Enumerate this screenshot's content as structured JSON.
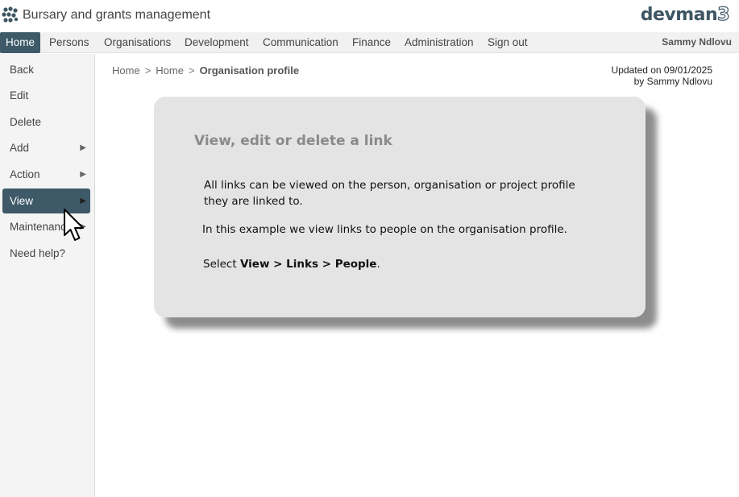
{
  "header": {
    "app_title": "Bursary and grants management",
    "brand_text": "devman",
    "brand_num": "3",
    "logo_icon": "molecule-dots-icon"
  },
  "topnav": {
    "items": [
      "Home",
      "Persons",
      "Organisations",
      "Development",
      "Communication",
      "Finance",
      "Administration",
      "Sign out"
    ],
    "active": "Home",
    "user": "Sammy Ndlovu"
  },
  "sidebar": {
    "items": [
      {
        "label": "Back",
        "has_submenu": false
      },
      {
        "label": "Edit",
        "has_submenu": false
      },
      {
        "label": "Delete",
        "has_submenu": false
      },
      {
        "label": "Add",
        "has_submenu": true
      },
      {
        "label": "Action",
        "has_submenu": true
      },
      {
        "label": "View",
        "has_submenu": true
      },
      {
        "label": "Maintenance",
        "has_submenu": true
      },
      {
        "label": "Need help?",
        "has_submenu": false
      }
    ],
    "active": "View",
    "arrow_glyph": "▶"
  },
  "breadcrumb": {
    "items": [
      "Home",
      "Home"
    ],
    "separator": ">",
    "current": "Organisation profile"
  },
  "updated": {
    "line1": "Updated on 09/01/2025",
    "line2": "by Sammy Ndlovu"
  },
  "card": {
    "title": "View, edit or delete a link",
    "text1": "All links can be viewed on the person, organisation or project profile they are linked to.",
    "text2": "In this example we view links to people on the organisation profile.",
    "text3_prefix": "Select ",
    "text3_bold": "View > Links > People",
    "text3_suffix": "."
  },
  "colors": {
    "accent": "#3e5a69",
    "card_bg": "#e4e4e4",
    "nav_bg": "#f1f1f1",
    "sidebar_bg": "#f4f4f4"
  }
}
